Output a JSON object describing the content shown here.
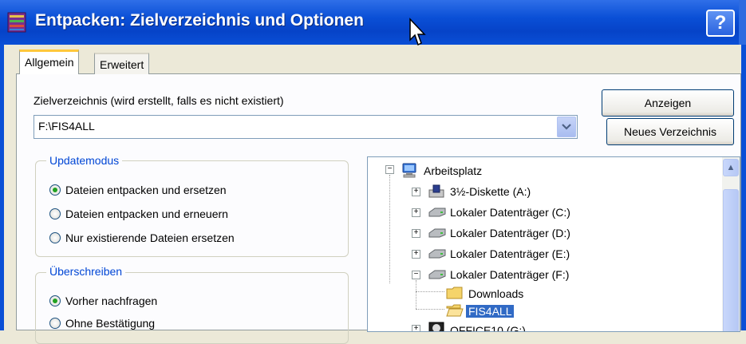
{
  "window": {
    "title": "Entpacken: Zielverzeichnis und Optionen",
    "help_label": "?"
  },
  "tabs": [
    {
      "label": "Allgemein",
      "active": true
    },
    {
      "label": "Erweitert",
      "active": false
    }
  ],
  "destination": {
    "label": "Zielverzeichnis (wird erstellt, falls es nicht existiert)",
    "value": "F:\\FIS4ALL"
  },
  "buttons": {
    "show_label": "Anzeigen",
    "new_dir_label": "Neues Verzeichnis"
  },
  "update_mode": {
    "legend": "Updatemodus",
    "options": [
      {
        "label": "Dateien entpacken und ersetzen",
        "checked": true
      },
      {
        "label": "Dateien entpacken und erneuern",
        "checked": false
      },
      {
        "label": "Nur existierende Dateien ersetzen",
        "checked": false
      }
    ]
  },
  "overwrite": {
    "legend": "Überschreiben",
    "options": [
      {
        "label": "Vorher nachfragen",
        "checked": true
      },
      {
        "label": "Ohne Bestätigung",
        "checked": false
      }
    ]
  },
  "tree": {
    "items": [
      {
        "label": "Arbeitsplatz",
        "icon": "computer-icon"
      },
      {
        "label": "3½-Diskette (A:)",
        "icon": "floppy-drive-icon"
      },
      {
        "label": "Lokaler Datenträger (C:)",
        "icon": "hard-drive-icon"
      },
      {
        "label": "Lokaler Datenträger (D:)",
        "icon": "hard-drive-icon"
      },
      {
        "label": "Lokaler Datenträger (E:)",
        "icon": "hard-drive-icon"
      },
      {
        "label": "Lokaler Datenträger (F:)",
        "icon": "hard-drive-icon"
      },
      {
        "label": "Downloads",
        "icon": "folder-icon"
      },
      {
        "label": "FIS4ALL",
        "icon": "open-folder-icon",
        "selected": true
      },
      {
        "label": "OFFICE10 (G:)",
        "icon": "cd-drive-icon"
      }
    ]
  },
  "colors": {
    "titlebar": "#0a4fd6",
    "accent": "#0046d5",
    "selection": "#316ac5"
  }
}
